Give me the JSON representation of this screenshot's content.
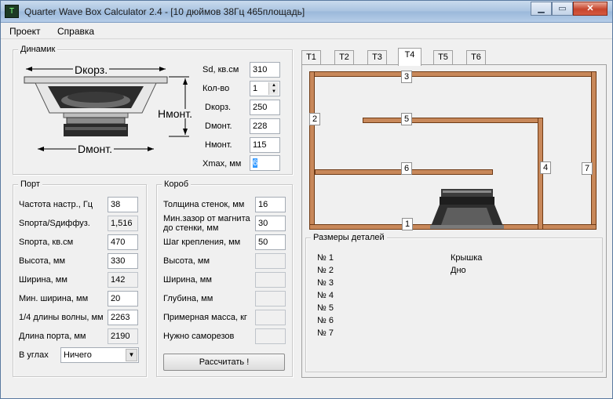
{
  "window": {
    "title": "Quarter Wave Box Calculator 2.4 - [10 дюймов 38Гц 465площадь]",
    "icon": "terminal-app-icon",
    "buttons": {
      "minimize": "▁",
      "maximize": "▭",
      "close": "✕"
    }
  },
  "menu": [
    "Проект",
    "Справка"
  ],
  "speaker": {
    "group_label": "Динамик",
    "diagram_labels": {
      "d_outer": "Dкорз.",
      "d_mount": "Dмонт.",
      "h_mount": "Hмонт."
    },
    "fields": [
      {
        "label": "Sd, кв.см",
        "value": "310"
      },
      {
        "label": "Кол-во",
        "value": "1"
      },
      {
        "label": "Dкорз.",
        "value": "250"
      },
      {
        "label": "Dмонт.",
        "value": "228"
      },
      {
        "label": "Hмонт.",
        "value": "115"
      },
      {
        "label": "Xmax, мм",
        "value": "6"
      }
    ]
  },
  "port": {
    "group_label": "Порт",
    "fields": [
      {
        "label": "Частота настр., Гц",
        "value": "38"
      },
      {
        "label": "Sпорта/Sдиффуз.",
        "value": "1,516"
      },
      {
        "label": "Sпорта, кв.см",
        "value": "470"
      },
      {
        "label": "Высота, мм",
        "value": "330"
      },
      {
        "label": "Ширина, мм",
        "value": "142"
      },
      {
        "label": "Мин. ширина, мм",
        "value": "20"
      },
      {
        "label": "1/4 длины волны, мм",
        "value": "2263"
      },
      {
        "label": "Длина порта, мм",
        "value": "2190"
      }
    ],
    "corners_label": "В углах",
    "corners_value": "Ничего"
  },
  "box": {
    "group_label": "Короб",
    "fields": [
      {
        "label": "Толщина стенок, мм",
        "value": "16"
      },
      {
        "label": "Мин.зазор от магнита до стенки, мм",
        "value": "30"
      },
      {
        "label": "Шаг крепления, мм",
        "value": "50"
      },
      {
        "label": "Высота, мм",
        "value": ""
      },
      {
        "label": "Ширина, мм",
        "value": ""
      },
      {
        "label": "Глубина, мм",
        "value": ""
      },
      {
        "label": "Примерная масса, кг",
        "value": ""
      },
      {
        "label": "Нужно саморезов",
        "value": ""
      }
    ],
    "calculate_label": "Рассчитать !"
  },
  "tabs": [
    "T1",
    "T2",
    "T3",
    "T4",
    "T5",
    "T6"
  ],
  "active_tab": "T4",
  "panel_labels": [
    "1",
    "2",
    "3",
    "4",
    "5",
    "6",
    "7"
  ],
  "colors": {
    "board": "#c8885a",
    "board_edge": "#6f3b16"
  },
  "parts": {
    "group_label": "Размеры деталей",
    "items": [
      "№ 1",
      "№ 2",
      "№ 3",
      "№ 4",
      "№ 5",
      "№ 6",
      "№ 7"
    ],
    "names": [
      "Крышка",
      "Дно"
    ]
  }
}
